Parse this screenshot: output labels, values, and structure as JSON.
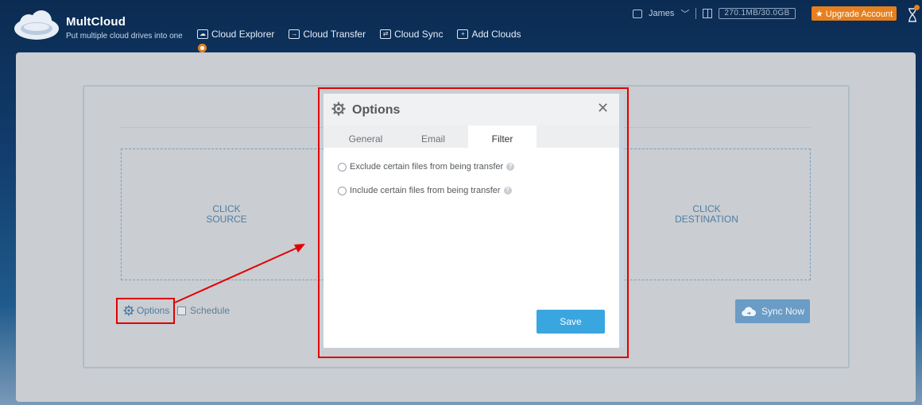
{
  "header": {
    "brand": "MultCloud",
    "tagline": "Put multiple cloud drives into one",
    "nav": [
      {
        "label": "Cloud Explorer",
        "icon": "cloud-explorer-icon"
      },
      {
        "label": "Cloud Transfer",
        "icon": "cloud-transfer-icon"
      },
      {
        "label": "Cloud Sync",
        "icon": "cloud-sync-icon"
      },
      {
        "label": "Add Clouds",
        "icon": "add-clouds-icon"
      }
    ],
    "user_name": "James",
    "storage": "270.1MB/30.0GB",
    "upgrade_label": "★ Upgrade Account"
  },
  "main": {
    "source_label_1": "CLICK",
    "source_label_2": "SOURCE",
    "destination_label_1": "CLICK",
    "destination_label_2": "DESTINATION",
    "options_label": "Options",
    "schedule_label": "Schedule",
    "sync_now_label": "Sync Now"
  },
  "modal": {
    "title": "Options",
    "close_glyph": "✕",
    "tabs": [
      "General",
      "Email",
      "Filter"
    ],
    "active_tab": "Filter",
    "filter_options": [
      "Exclude certain files from being transfer",
      "Include certain files from being transfer"
    ],
    "help_glyph": "?",
    "save_label": "Save"
  },
  "colors": {
    "accent_orange": "#e6801f",
    "save_blue": "#3aa6e0",
    "sync_blue": "#6a9cc6",
    "highlight_red": "#e10000"
  }
}
